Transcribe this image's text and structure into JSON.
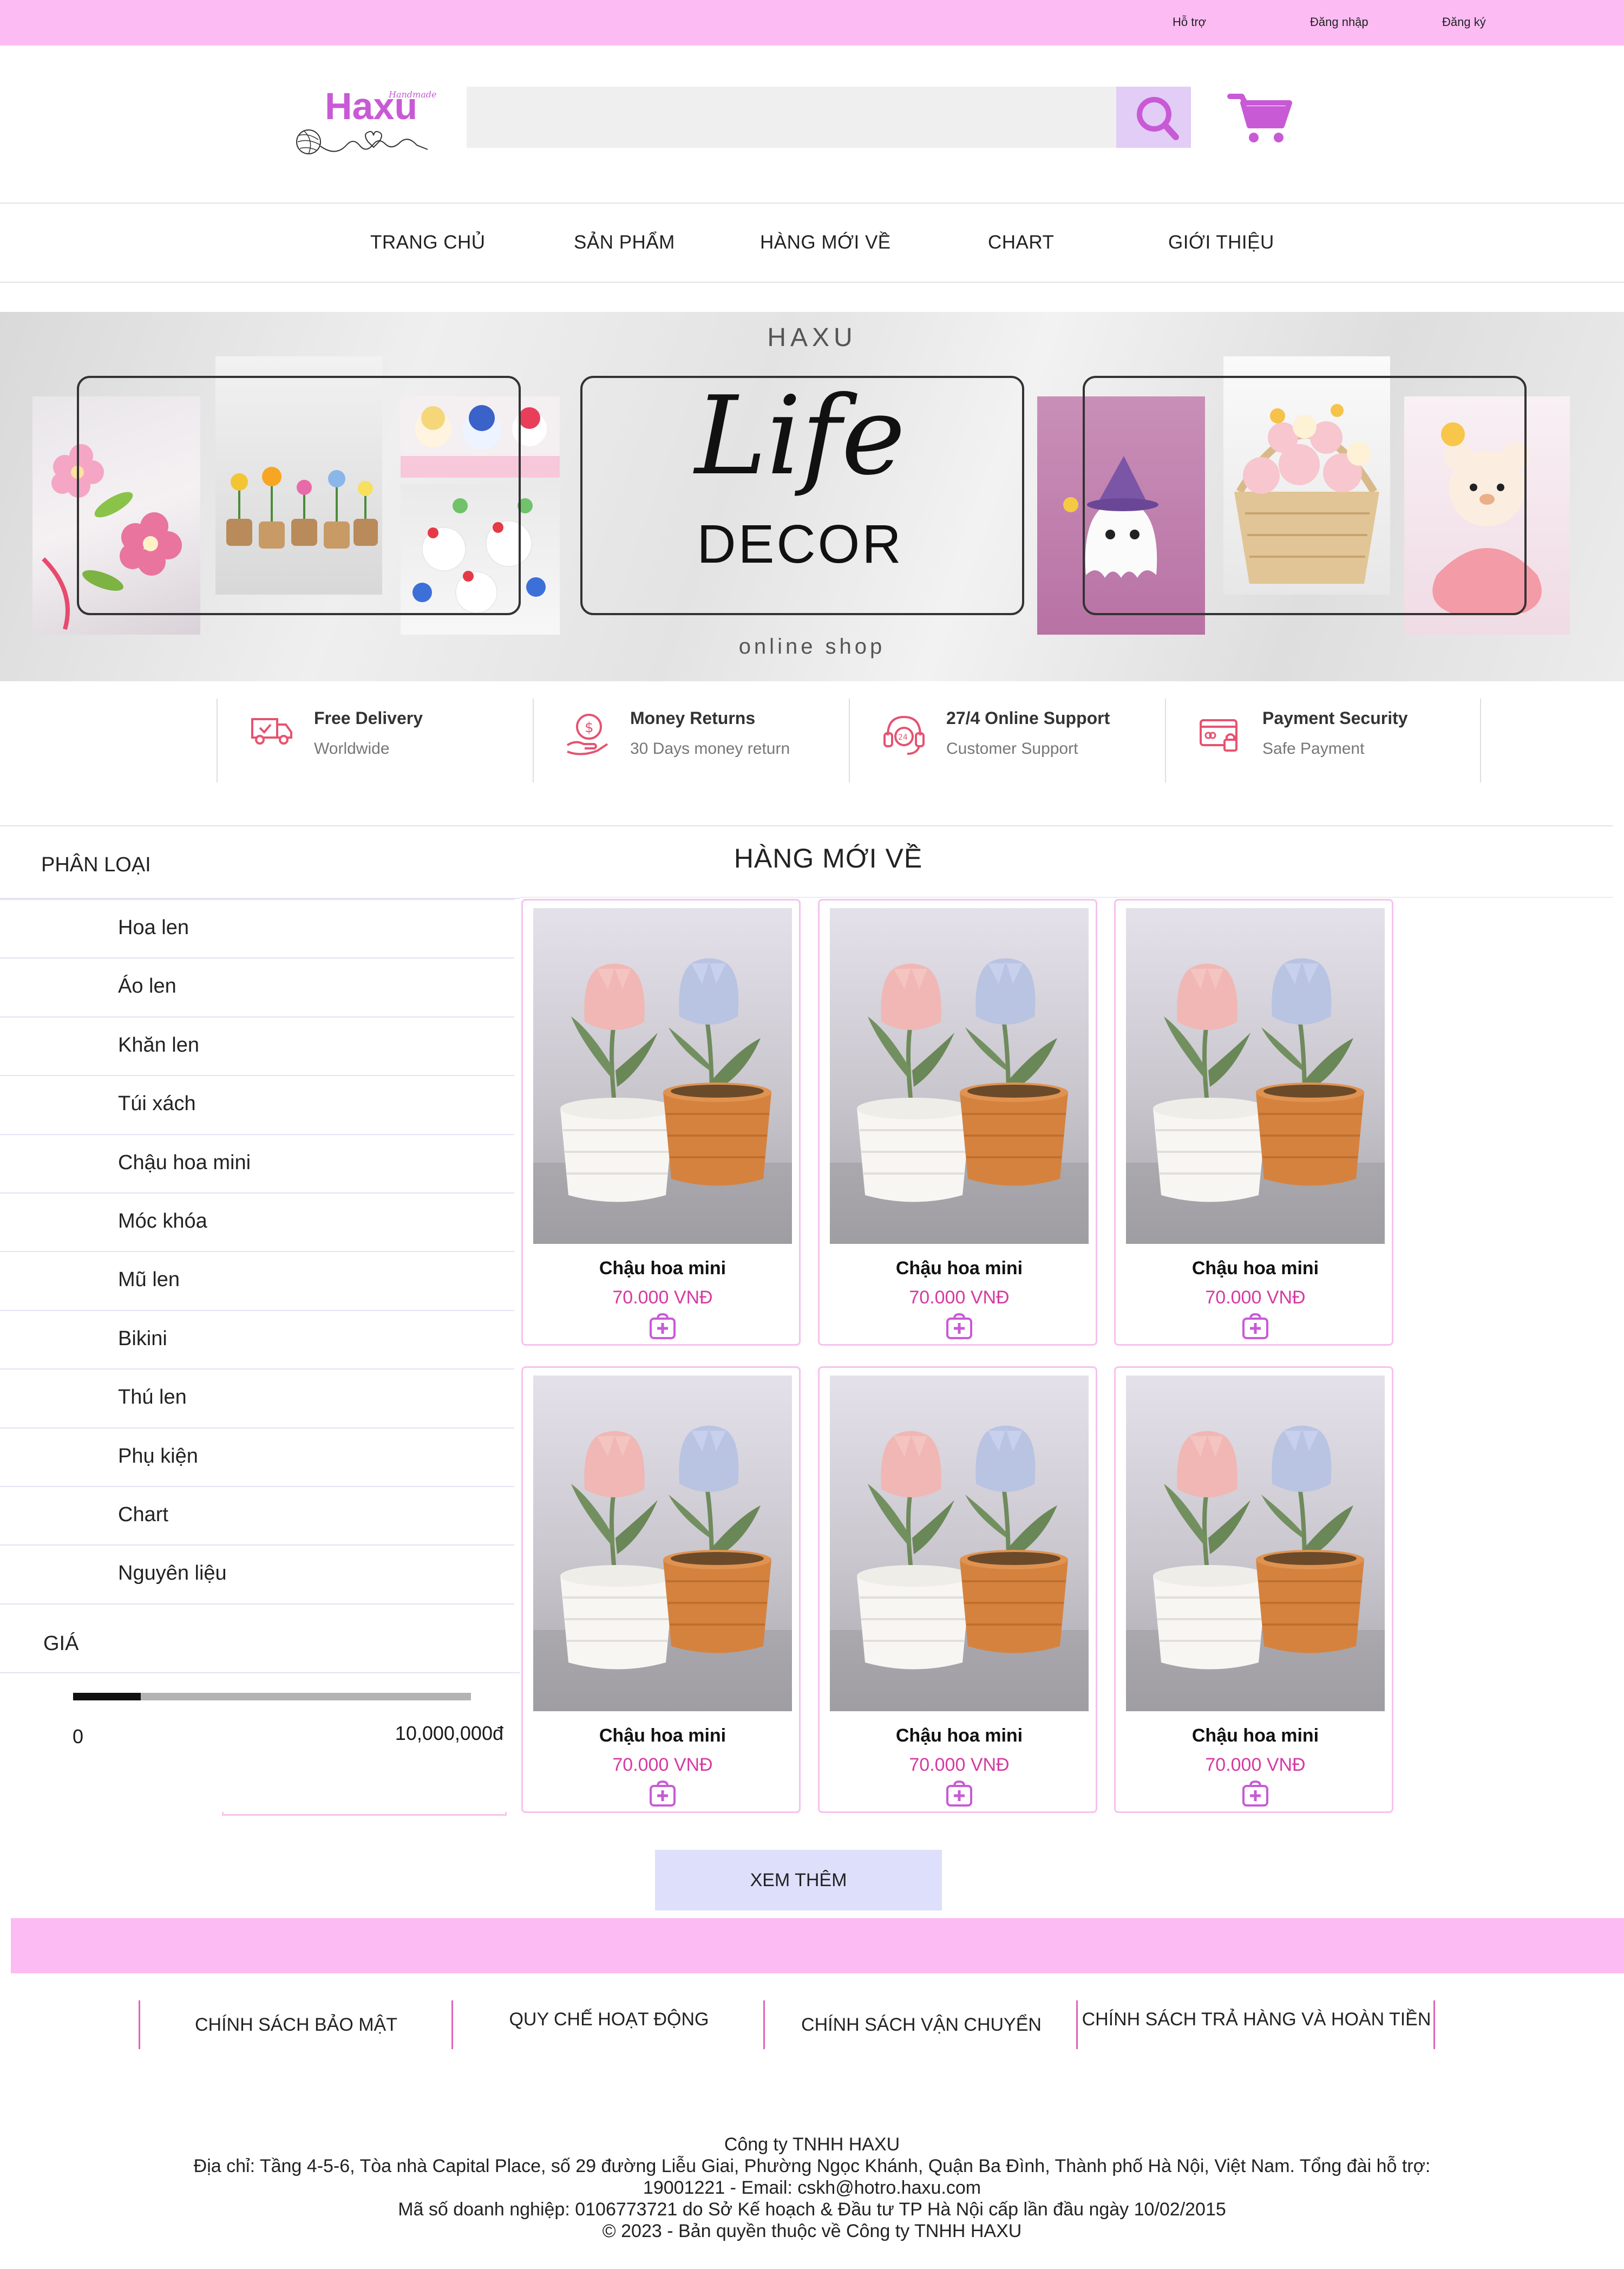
{
  "topbar": {
    "support": "Hỗ trợ",
    "login": "Đăng nhập",
    "register": "Đăng ký"
  },
  "brand": {
    "logo_text": "Haxu",
    "logo_tag": "Handmade",
    "accent": "#c85ad6",
    "pink": "#fcbcf3"
  },
  "search": {
    "placeholder": "",
    "value": ""
  },
  "nav": {
    "home": "TRANG CHỦ",
    "products": "SẢN PHẨM",
    "new_arrivals": "HÀNG MỚI VỀ",
    "chart": "CHART",
    "about": "GIỚI THIỆU"
  },
  "banner": {
    "title": "HAXU",
    "center_script": "Life",
    "center_word": "DECOR",
    "subtitle": "online shop"
  },
  "features": [
    {
      "title": "Free Delivery",
      "subtitle": "Worldwide",
      "icon": "truck-icon"
    },
    {
      "title": "Money Returns",
      "subtitle": "30 Days money return",
      "icon": "money-return-icon"
    },
    {
      "title": "27/4 Online Support",
      "subtitle": "Customer Support",
      "icon": "headset-icon"
    },
    {
      "title": "Payment Security",
      "subtitle": "Safe Payment",
      "icon": "card-icon"
    }
  ],
  "sidebar": {
    "category_heading": "PHÂN LOẠI",
    "categories": [
      "Hoa len",
      "Áo len",
      "Khăn len",
      "Túi xách",
      "Chậu hoa mini",
      "Móc khóa",
      "Mũ len",
      "Bikini",
      "Thú len",
      "Phụ kiện",
      "Chart",
      "Nguyên liệu"
    ],
    "price_heading": "GIÁ",
    "price_min": "0",
    "price_max": "10,000,000đ",
    "price_fill_fraction": 0.17
  },
  "products_section": {
    "title": "HÀNG MỚI VỀ",
    "items": [
      {
        "name": "Chậu hoa mini",
        "price": "70.000 VNĐ"
      },
      {
        "name": "Chậu hoa mini",
        "price": "70.000 VNĐ"
      },
      {
        "name": "Chậu hoa mini",
        "price": "70.000 VNĐ"
      },
      {
        "name": "Chậu hoa mini",
        "price": "70.000 VNĐ"
      },
      {
        "name": "Chậu hoa mini",
        "price": "70.000 VNĐ"
      },
      {
        "name": "Chậu hoa mini",
        "price": "70.000 VNĐ"
      }
    ],
    "more_label": "XEM THÊM"
  },
  "footer": {
    "policies": [
      "CHÍNH SÁCH BẢO MẬT",
      "QUY CHẾ HOẠT ĐỘNG",
      "CHÍNH SÁCH VẬN CHUYỂN",
      "CHÍNH SÁCH TRẢ HÀNG VÀ HOÀN TIỀN"
    ],
    "company_name": "Công ty TNHH HAXU",
    "address": "Địa chỉ: Tầng 4-5-6, Tòa nhà Capital Place, số 29 đường Liễu Giai, Phường Ngọc Khánh, Quận Ba Đình, Thành phố Hà Nội, Việt Nam. Tổng đài hỗ trợ: 19001221 - Email: cskh@hotro.haxu.com",
    "business_code": "Mã số doanh nghiệp: 0106773721 do Sở Kế hoạch & Đầu tư TP Hà Nội cấp lần đầu ngày 10/02/2015",
    "copyright": "© 2023 - Bản quyền thuộc về Công ty TNHH HAXU"
  }
}
